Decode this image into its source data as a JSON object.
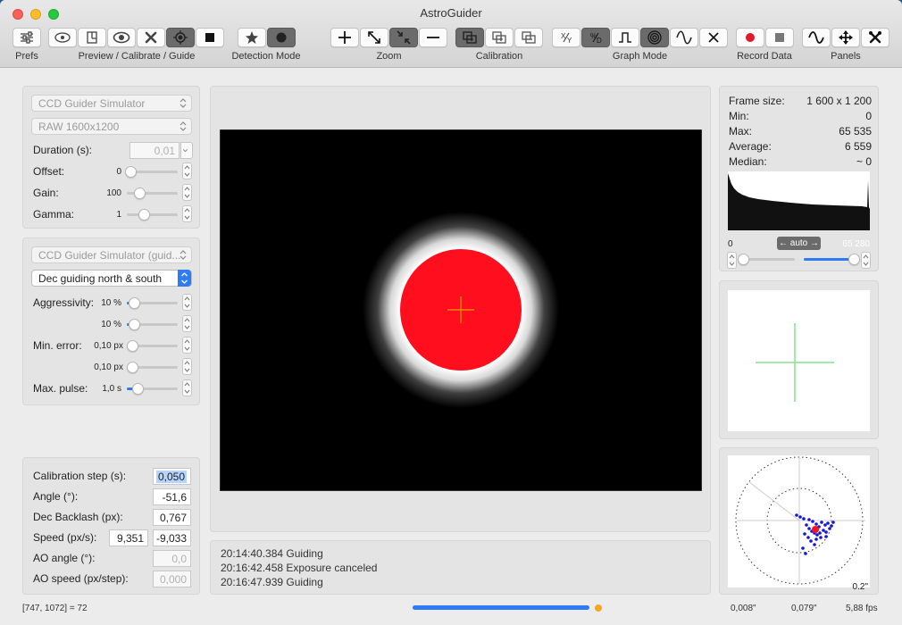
{
  "window": {
    "title": "AstroGuider"
  },
  "toolbar": {
    "groups": [
      {
        "label": "Prefs"
      },
      {
        "label": "Preview / Calibrate / Guide"
      },
      {
        "label": "Detection Mode"
      },
      {
        "label": "Zoom"
      },
      {
        "label": "Calibration"
      },
      {
        "label": "Graph Mode"
      },
      {
        "label": "Record Data"
      },
      {
        "label": "Panels"
      }
    ]
  },
  "camera": {
    "device": "CCD Guider Simulator",
    "mode": "RAW 1600x1200",
    "duration_label": "Duration (s):",
    "duration_value": "0,01",
    "offset_label": "Offset:",
    "offset_value": "0",
    "gain_label": "Gain:",
    "gain_value": "100",
    "gamma_label": "Gamma:",
    "gamma_value": "1"
  },
  "guider": {
    "device": "CCD Guider Simulator (guid...",
    "dec_mode": "Dec guiding north & south",
    "aggressivity_label": "Aggressivity:",
    "aggr_ra": "10 %",
    "aggr_dec": "10 %",
    "min_error_label": "Min. error:",
    "min_err_ra": "0,10 px",
    "min_err_dec": "0,10 px",
    "max_pulse_label": "Max. pulse:",
    "max_pulse": "1,0 s"
  },
  "calibration": {
    "step_label": "Calibration step (s):",
    "step_value": "0,050",
    "angle_label": "Angle (°):",
    "angle_value": "-51,6",
    "backlash_label": "Dec Backlash (px):",
    "backlash_value": "0,767",
    "speed_label": "Speed (px/s):",
    "speed_ra": "9,351",
    "speed_dec": "-9,033",
    "ao_angle_label": "AO angle (°):",
    "ao_angle_value": "0,0",
    "ao_speed_label": "AO speed (px/step):",
    "ao_speed_value": "0,000"
  },
  "log": [
    "20:14:40.384 Guiding",
    "20:16:42.458 Exposure canceled",
    "20:16:47.939 Guiding"
  ],
  "stats": {
    "frame_size_label": "Frame size:",
    "frame_size": "1 600 x 1 200",
    "min_label": "Min:",
    "min": "0",
    "max_label": "Max:",
    "max": "65 535",
    "average_label": "Average:",
    "average": "6 559",
    "median_label": "Median:",
    "median": "~ 0"
  },
  "histogram": {
    "low_value": "0",
    "auto_label": "← auto →",
    "high_value": "65 280",
    "low_level": 0.0,
    "high_level": 0.996
  },
  "scatter": {
    "scale_label": "0.2\"",
    "rms_ra": "0,008\"",
    "rms_dec": "0,079\"",
    "fps": "5,88 fps"
  },
  "status": {
    "pixel_readout": "[747, 1072] = 72",
    "progress": 1.0
  },
  "colors": {
    "accent": "#2f7bf5",
    "star": "#ff0e1e",
    "reticle": "#85e08f",
    "progress_dot": "#f5a623"
  }
}
